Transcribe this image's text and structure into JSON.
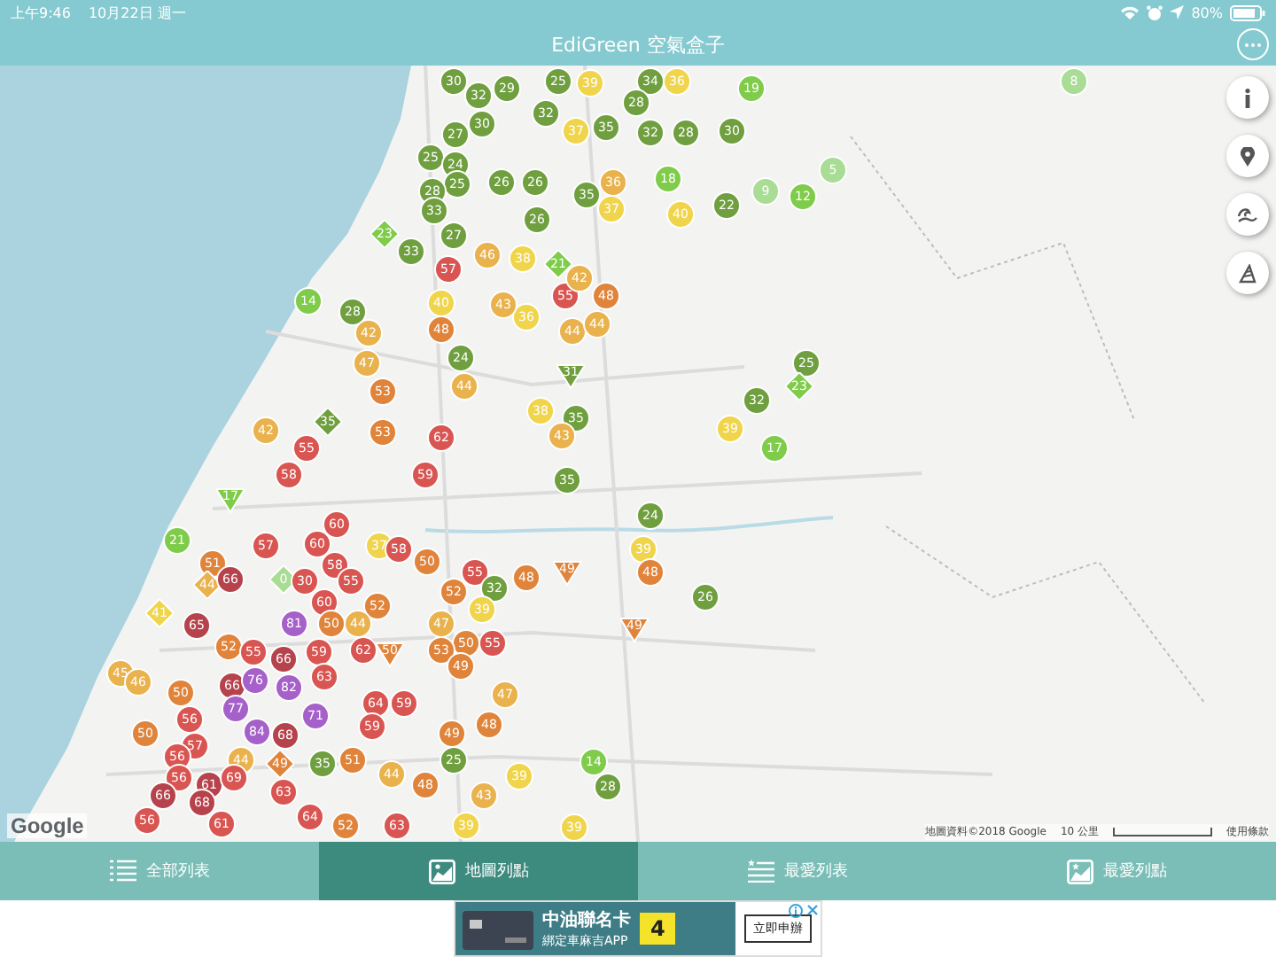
{
  "status_bar": {
    "time": "上午9:46",
    "date": "10月22日 週一",
    "battery": "80%"
  },
  "nav_bar": {
    "title": "EdiGreen 空氣盒子"
  },
  "map": {
    "markers": [
      {
        "value": "30",
        "color": "#6f9f3f",
        "kind": "circle"
      },
      {
        "value": "32",
        "color": "#6f9f3f",
        "kind": "circle"
      },
      {
        "value": "29",
        "color": "#6f9f3f",
        "kind": "circle"
      },
      {
        "value": "30",
        "color": "#6f9f3f",
        "kind": "circle"
      },
      {
        "value": "27",
        "color": "#6f9f3f",
        "kind": "circle"
      },
      {
        "value": "25",
        "color": "#6f9f3f",
        "kind": "circle"
      },
      {
        "value": "24",
        "color": "#6f9f3f",
        "kind": "circle"
      },
      {
        "value": "25",
        "color": "#6f9f3f",
        "kind": "circle"
      },
      {
        "value": "28",
        "color": "#6f9f3f",
        "kind": "circle"
      },
      {
        "value": "33",
        "color": "#6f9f3f",
        "kind": "circle"
      },
      {
        "value": "27",
        "color": "#6f9f3f",
        "kind": "circle"
      },
      {
        "value": "23",
        "color": "#7fcc4a",
        "kind": "diamond"
      },
      {
        "value": "33",
        "color": "#6f9f3f",
        "kind": "circle"
      },
      {
        "value": "14",
        "color": "#7fcc4a",
        "kind": "circle"
      },
      {
        "value": "28",
        "color": "#6f9f3f",
        "kind": "circle"
      },
      {
        "value": "25",
        "color": "#6f9f3f",
        "kind": "circle"
      },
      {
        "value": "39",
        "color": "#f0d54c",
        "kind": "circle"
      },
      {
        "value": "34",
        "color": "#6f9f3f",
        "kind": "circle"
      },
      {
        "value": "36",
        "color": "#f0d54c",
        "kind": "circle"
      },
      {
        "value": "19",
        "color": "#7fcc4a",
        "kind": "circle"
      },
      {
        "value": "32",
        "color": "#6f9f3f",
        "kind": "circle"
      },
      {
        "value": "37",
        "color": "#f0d54c",
        "kind": "circle"
      },
      {
        "value": "35",
        "color": "#6f9f3f",
        "kind": "circle"
      },
      {
        "value": "28",
        "color": "#6f9f3f",
        "kind": "circle"
      },
      {
        "value": "32",
        "color": "#6f9f3f",
        "kind": "circle"
      },
      {
        "value": "28",
        "color": "#6f9f3f",
        "kind": "circle"
      },
      {
        "value": "30",
        "color": "#6f9f3f",
        "kind": "circle"
      },
      {
        "value": "18",
        "color": "#7fcc4a",
        "kind": "circle"
      },
      {
        "value": "40",
        "color": "#f0d54c",
        "kind": "circle"
      },
      {
        "value": "22",
        "color": "#6f9f3f",
        "kind": "circle"
      },
      {
        "value": "9",
        "color": "#a9dc94",
        "kind": "circle"
      },
      {
        "value": "12",
        "color": "#7fcc4a",
        "kind": "circle"
      },
      {
        "value": "5",
        "color": "#a9dc94",
        "kind": "circle"
      },
      {
        "value": "26",
        "color": "#6f9f3f",
        "kind": "circle"
      },
      {
        "value": "26",
        "color": "#6f9f3f",
        "kind": "circle"
      },
      {
        "value": "36",
        "color": "#e9b24d",
        "kind": "circle"
      },
      {
        "value": "35",
        "color": "#6f9f3f",
        "kind": "circle"
      },
      {
        "value": "26",
        "color": "#6f9f3f",
        "kind": "circle"
      },
      {
        "value": "37",
        "color": "#f0d54c",
        "kind": "circle"
      },
      {
        "value": "38",
        "color": "#f0d54c",
        "kind": "circle"
      },
      {
        "value": "21",
        "color": "#7fcc4a",
        "kind": "diamond"
      },
      {
        "value": "46",
        "color": "#e9b24d",
        "kind": "circle"
      },
      {
        "value": "57",
        "color": "#d95552",
        "kind": "circle"
      },
      {
        "value": "40",
        "color": "#f0d54c",
        "kind": "circle"
      },
      {
        "value": "48",
        "color": "#e0843b",
        "kind": "circle"
      },
      {
        "value": "55",
        "color": "#d95552",
        "kind": "circle"
      },
      {
        "value": "42",
        "color": "#e9b24d",
        "kind": "circle"
      },
      {
        "value": "48",
        "color": "#e0843b",
        "kind": "circle"
      },
      {
        "value": "36",
        "color": "#f0d54c",
        "kind": "circle"
      },
      {
        "value": "43",
        "color": "#e9b24d",
        "kind": "circle"
      },
      {
        "value": "44",
        "color": "#e9b24d",
        "kind": "circle"
      },
      {
        "value": "44",
        "color": "#e9b24d",
        "kind": "circle"
      },
      {
        "value": "42",
        "color": "#e9b24d",
        "kind": "circle"
      },
      {
        "value": "47",
        "color": "#e9b24d",
        "kind": "circle"
      },
      {
        "value": "53",
        "color": "#e0843b",
        "kind": "circle"
      },
      {
        "value": "24",
        "color": "#6f9f3f",
        "kind": "circle"
      },
      {
        "value": "44",
        "color": "#e9b24d",
        "kind": "circle"
      },
      {
        "value": "31",
        "color": "#6f9f3f",
        "kind": "triangle"
      },
      {
        "value": "35",
        "color": "#6f9f3f",
        "kind": "circle"
      },
      {
        "value": "43",
        "color": "#e9b24d",
        "kind": "circle"
      },
      {
        "value": "38",
        "color": "#f0d54c",
        "kind": "circle"
      },
      {
        "value": "62",
        "color": "#d95552",
        "kind": "circle"
      },
      {
        "value": "59",
        "color": "#d95552",
        "kind": "circle"
      },
      {
        "value": "53",
        "color": "#e0843b",
        "kind": "circle"
      },
      {
        "value": "35",
        "color": "#6f9f3f",
        "kind": "diamond"
      },
      {
        "value": "55",
        "color": "#d95552",
        "kind": "circle"
      },
      {
        "value": "58",
        "color": "#d95552",
        "kind": "circle"
      },
      {
        "value": "42",
        "color": "#e9b24d",
        "kind": "circle"
      },
      {
        "value": "17",
        "color": "#7fcc4a",
        "kind": "triangle"
      },
      {
        "value": "35",
        "color": "#6f9f3f",
        "kind": "circle"
      },
      {
        "value": "24",
        "color": "#6f9f3f",
        "kind": "circle"
      },
      {
        "value": "25",
        "color": "#6f9f3f",
        "kind": "circle"
      },
      {
        "value": "23",
        "color": "#7fcc4a",
        "kind": "diamond"
      },
      {
        "value": "32",
        "color": "#6f9f3f",
        "kind": "circle"
      },
      {
        "value": "17",
        "color": "#7fcc4a",
        "kind": "circle"
      },
      {
        "value": "39",
        "color": "#f0d54c",
        "kind": "circle"
      },
      {
        "value": "39",
        "color": "#f0d54c",
        "kind": "circle"
      },
      {
        "value": "48",
        "color": "#e0843b",
        "kind": "circle"
      },
      {
        "value": "26",
        "color": "#6f9f3f",
        "kind": "circle"
      },
      {
        "value": "49",
        "color": "#e0843b",
        "kind": "triangle"
      },
      {
        "value": "21",
        "color": "#7fcc4a",
        "kind": "circle"
      },
      {
        "value": "57",
        "color": "#d95552",
        "kind": "circle"
      },
      {
        "value": "51",
        "color": "#e0843b",
        "kind": "circle"
      },
      {
        "value": "44",
        "color": "#e9b24d",
        "kind": "diamond"
      },
      {
        "value": "66",
        "color": "#b6434c",
        "kind": "circle"
      },
      {
        "value": "0",
        "color": "#a9dc94",
        "kind": "diamond"
      },
      {
        "value": "41",
        "color": "#f0d54c",
        "kind": "diamond"
      },
      {
        "value": "65",
        "color": "#b6434c",
        "kind": "circle"
      },
      {
        "value": "30",
        "color": "#d95552",
        "kind": "circle"
      },
      {
        "value": "60",
        "color": "#d95552",
        "kind": "circle"
      },
      {
        "value": "60",
        "color": "#d95552",
        "kind": "circle"
      },
      {
        "value": "58",
        "color": "#d95552",
        "kind": "circle"
      },
      {
        "value": "55",
        "color": "#d95552",
        "kind": "circle"
      },
      {
        "value": "60",
        "color": "#d95552",
        "kind": "circle"
      },
      {
        "value": "37",
        "color": "#f0d54c",
        "kind": "circle"
      },
      {
        "value": "58",
        "color": "#d95552",
        "kind": "circle"
      },
      {
        "value": "50",
        "color": "#e0843b",
        "kind": "circle"
      },
      {
        "value": "52",
        "color": "#e0843b",
        "kind": "circle"
      },
      {
        "value": "50",
        "color": "#e0843b",
        "kind": "circle"
      },
      {
        "value": "44",
        "color": "#e9b24d",
        "kind": "circle"
      },
      {
        "value": "52",
        "color": "#e0843b",
        "kind": "circle"
      },
      {
        "value": "55",
        "color": "#d95552",
        "kind": "circle"
      },
      {
        "value": "81",
        "color": "#a660c9",
        "kind": "circle"
      },
      {
        "value": "66",
        "color": "#b6434c",
        "kind": "circle"
      },
      {
        "value": "59",
        "color": "#d95552",
        "kind": "circle"
      },
      {
        "value": "62",
        "color": "#d95552",
        "kind": "circle"
      },
      {
        "value": "50",
        "color": "#e0843b",
        "kind": "triangle"
      },
      {
        "value": "45",
        "color": "#e9b24d",
        "kind": "circle"
      },
      {
        "value": "46",
        "color": "#e9b24d",
        "kind": "circle"
      },
      {
        "value": "66",
        "color": "#b6434c",
        "kind": "circle"
      },
      {
        "value": "76",
        "color": "#a660c9",
        "kind": "circle"
      },
      {
        "value": "82",
        "color": "#a660c9",
        "kind": "circle"
      },
      {
        "value": "63",
        "color": "#d95552",
        "kind": "circle"
      },
      {
        "value": "50",
        "color": "#e0843b",
        "kind": "circle"
      },
      {
        "value": "56",
        "color": "#d95552",
        "kind": "circle"
      },
      {
        "value": "77",
        "color": "#a660c9",
        "kind": "circle"
      },
      {
        "value": "50",
        "color": "#e0843b",
        "kind": "circle"
      },
      {
        "value": "57",
        "color": "#d95552",
        "kind": "circle"
      },
      {
        "value": "84",
        "color": "#a660c9",
        "kind": "circle"
      },
      {
        "value": "68",
        "color": "#b6434c",
        "kind": "circle"
      },
      {
        "value": "71",
        "color": "#a660c9",
        "kind": "circle"
      },
      {
        "value": "44",
        "color": "#e9b24d",
        "kind": "circle"
      },
      {
        "value": "49",
        "color": "#e0843b",
        "kind": "diamond"
      },
      {
        "value": "56",
        "color": "#d95552",
        "kind": "circle"
      },
      {
        "value": "56",
        "color": "#d95552",
        "kind": "circle"
      },
      {
        "value": "61",
        "color": "#b6434c",
        "kind": "circle"
      },
      {
        "value": "69",
        "color": "#d95552",
        "kind": "circle"
      },
      {
        "value": "66",
        "color": "#b6434c",
        "kind": "circle"
      },
      {
        "value": "68",
        "color": "#b6434c",
        "kind": "circle"
      },
      {
        "value": "63",
        "color": "#d95552",
        "kind": "circle"
      },
      {
        "value": "64",
        "color": "#d95552",
        "kind": "circle"
      },
      {
        "value": "56",
        "color": "#d95552",
        "kind": "circle"
      },
      {
        "value": "61",
        "color": "#d95552",
        "kind": "circle"
      },
      {
        "value": "64",
        "color": "#d95552",
        "kind": "circle"
      },
      {
        "value": "59",
        "color": "#d95552",
        "kind": "circle"
      },
      {
        "value": "59",
        "color": "#d95552",
        "kind": "circle"
      },
      {
        "value": "35",
        "color": "#6f9f3f",
        "kind": "circle"
      },
      {
        "value": "51",
        "color": "#e0843b",
        "kind": "circle"
      },
      {
        "value": "44",
        "color": "#e9b24d",
        "kind": "circle"
      },
      {
        "value": "48",
        "color": "#e0843b",
        "kind": "circle"
      },
      {
        "value": "49",
        "color": "#e0843b",
        "kind": "circle"
      },
      {
        "value": "25",
        "color": "#6f9f3f",
        "kind": "circle"
      },
      {
        "value": "48",
        "color": "#e0843b",
        "kind": "circle"
      },
      {
        "value": "47",
        "color": "#e9b24d",
        "kind": "circle"
      },
      {
        "value": "43",
        "color": "#e9b24d",
        "kind": "circle"
      },
      {
        "value": "39",
        "color": "#f0d54c",
        "kind": "circle"
      },
      {
        "value": "14",
        "color": "#7fcc4a",
        "kind": "circle"
      },
      {
        "value": "28",
        "color": "#6f9f3f",
        "kind": "circle"
      },
      {
        "value": "55",
        "color": "#d95552",
        "kind": "circle"
      },
      {
        "value": "48",
        "color": "#e0843b",
        "kind": "circle"
      },
      {
        "value": "32",
        "color": "#6f9f3f",
        "kind": "circle"
      },
      {
        "value": "39",
        "color": "#f0d54c",
        "kind": "circle"
      },
      {
        "value": "52",
        "color": "#e0843b",
        "kind": "circle"
      },
      {
        "value": "47",
        "color": "#e9b24d",
        "kind": "circle"
      },
      {
        "value": "50",
        "color": "#e0843b",
        "kind": "circle"
      },
      {
        "value": "53",
        "color": "#e0843b",
        "kind": "circle"
      },
      {
        "value": "49",
        "color": "#e0843b",
        "kind": "circle"
      },
      {
        "value": "55",
        "color": "#d95552",
        "kind": "circle"
      },
      {
        "value": "49",
        "color": "#e0843b",
        "kind": "triangle"
      },
      {
        "value": "52",
        "color": "#e0843b",
        "kind": "circle"
      },
      {
        "value": "63",
        "color": "#d95552",
        "kind": "circle"
      },
      {
        "value": "39",
        "color": "#f0d54c",
        "kind": "circle"
      },
      {
        "value": "39",
        "color": "#f0d54c",
        "kind": "circle"
      },
      {
        "value": "8",
        "color": "#a9dc94",
        "kind": "circle"
      }
    ],
    "logo": "Google",
    "attribution": "地圖資料©2018 Google",
    "scale": "10 公里",
    "terms": "使用條款"
  },
  "tabs": [
    {
      "label": "全部列表",
      "kind": "list",
      "selected": false
    },
    {
      "label": "地圖列點",
      "kind": "map",
      "selected": true
    },
    {
      "label": "最愛列表",
      "kind": "star-list",
      "selected": false
    },
    {
      "label": "最愛列點",
      "kind": "star-map",
      "selected": false
    }
  ],
  "ad": {
    "headline": "中油聯名卡",
    "subline": "綁定車麻吉APP",
    "badge": "4",
    "button": "立即申辦"
  }
}
